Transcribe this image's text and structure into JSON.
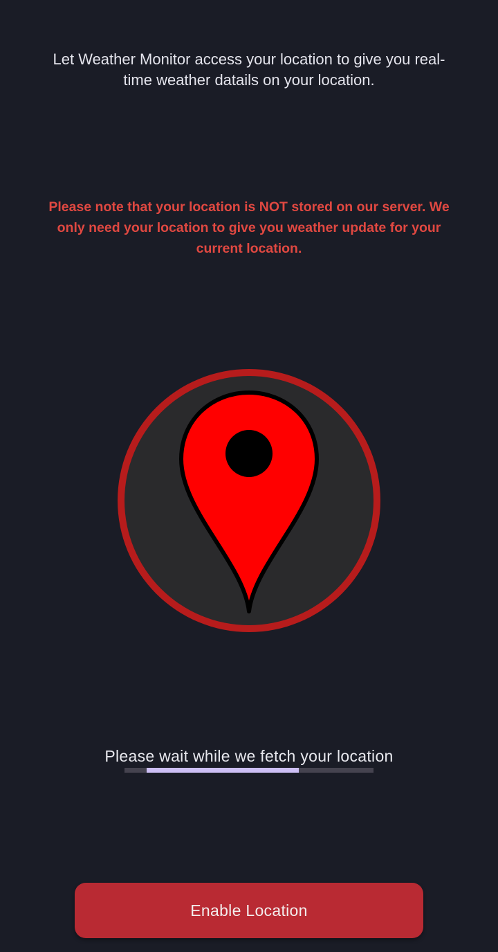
{
  "permission": {
    "intro_text": "Let Weather Monitor access your location to give you real-time weather datails on your location.",
    "privacy_notice": "Please note that your location is NOT stored on our server. We only need your location to give you weather update for your current location."
  },
  "illustration": {
    "icon": "location-pin-icon",
    "ring_color": "#b71c1c",
    "inner_color": "#2a2a2c",
    "pin_color": "#ff0000",
    "dot_color": "#000000"
  },
  "loading": {
    "status_text": "Please wait while we fetch your location",
    "progress_segment_start": 0.089,
    "progress_segment_end": 0.7
  },
  "actions": {
    "enable_location_label": "Enable Location"
  },
  "colors": {
    "background": "#1a1c26",
    "notice_text": "#e04841",
    "button": "#b92a33",
    "progress_track": "#45434f",
    "progress_fill": "#cdbff5"
  }
}
